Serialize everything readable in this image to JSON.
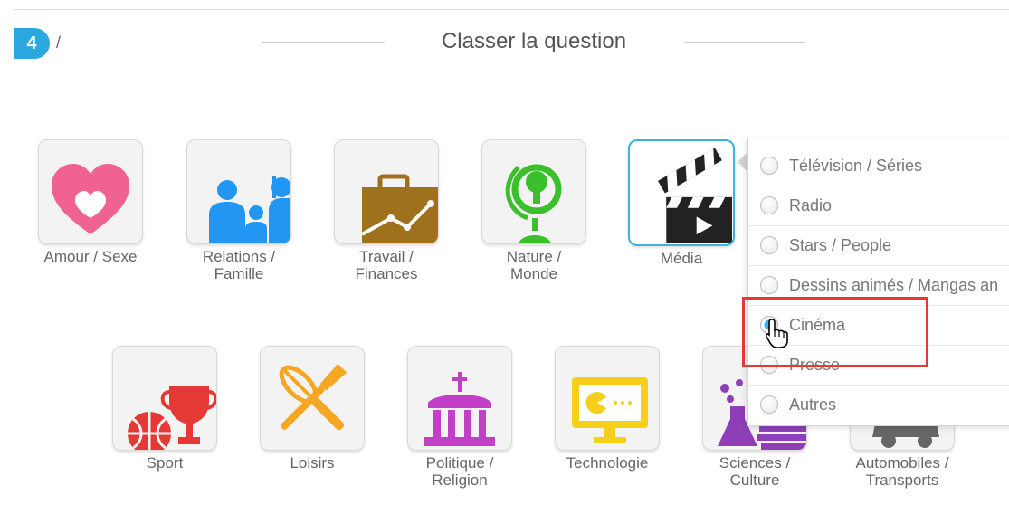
{
  "step": {
    "number": "4",
    "separator": "/"
  },
  "title": "Classer la question",
  "categories_row1": [
    {
      "label": "Amour / Sexe",
      "icon": "heart-icon",
      "color": "#f06292"
    },
    {
      "label": "Relations /\nFamille",
      "icon": "family-icon",
      "color": "#2196f3"
    },
    {
      "label": "Travail /\nFinances",
      "icon": "briefcase-icon",
      "color": "#a0711c"
    },
    {
      "label": "Nature /\nMonde",
      "icon": "globe-tree-icon",
      "color": "#3bbf2a"
    },
    {
      "label": "Média",
      "icon": "clapperboard-icon",
      "color": "#222222"
    }
  ],
  "categories_row2": [
    {
      "label": "Sport",
      "icon": "trophy-ball-icon",
      "color": "#e53935"
    },
    {
      "label": "Loisirs",
      "icon": "whisk-brush-icon",
      "color": "#f5a623"
    },
    {
      "label": "Politique /\nReligion",
      "icon": "building-icon",
      "color": "#c43fc8"
    },
    {
      "label": "Technologie",
      "icon": "monitor-icon",
      "color": "#f5cf1a"
    },
    {
      "label": "Sciences /\nCulture",
      "icon": "flask-books-icon",
      "color": "#8e3fb8"
    },
    {
      "label": "Automobiles /\nTransports",
      "icon": "car-icon",
      "color": "#666666"
    }
  ],
  "media_subcategories": [
    {
      "label": "Télévision / Séries",
      "checked": false
    },
    {
      "label": "Radio",
      "checked": false
    },
    {
      "label": "Stars / People",
      "checked": false
    },
    {
      "label": "Dessins animés / Mangas an",
      "checked": false
    },
    {
      "label": "Cinéma",
      "checked": true
    },
    {
      "label": "Presse",
      "checked": false
    },
    {
      "label": "Autres",
      "checked": false
    }
  ],
  "accent_color": "#2ba8e0",
  "highlight_color": "#e53935"
}
